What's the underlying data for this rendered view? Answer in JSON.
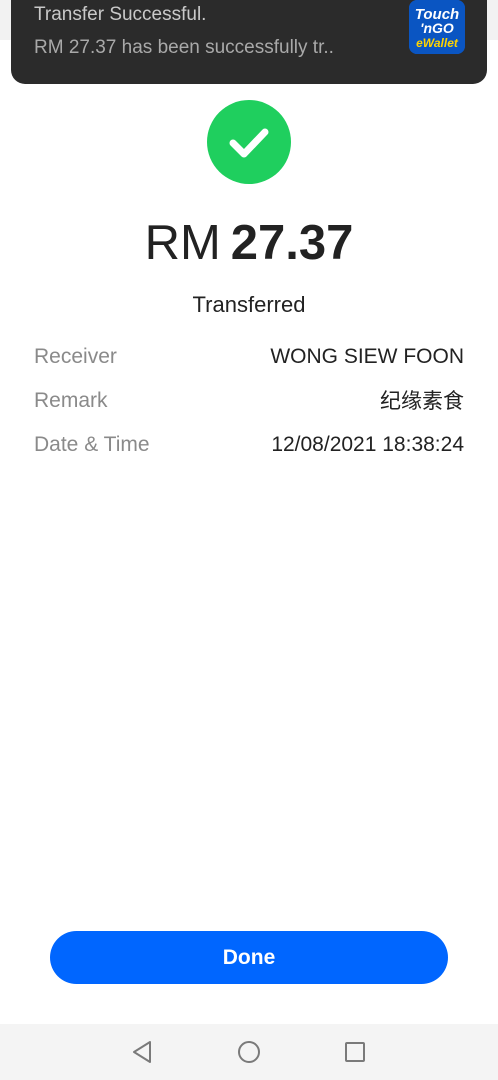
{
  "notification": {
    "title": "Transfer Successful.",
    "body": "RM 27.37 has been successfully tr..",
    "app_icon": "touch-n-go-ewallet-logo",
    "app_logo_text": "Touch 'n Go eWallet"
  },
  "status": {
    "icon": "checkmark-icon",
    "color": "#1fcf5e"
  },
  "amount": {
    "currency": "RM",
    "value": "27.37"
  },
  "status_text": "Transferred",
  "details": {
    "receiver_label": "Receiver",
    "receiver_value": "WONG SIEW FOON",
    "remark_label": "Remark",
    "remark_value": "纪缘素食",
    "datetime_label": "Date & Time",
    "datetime_value": "12/08/2021 18:38:24"
  },
  "done_button": {
    "label": "Done",
    "color": "#0066ff"
  },
  "nav_bar": {
    "back": "back-triangle-icon",
    "home": "home-circle-icon",
    "recents": "recents-square-icon"
  }
}
